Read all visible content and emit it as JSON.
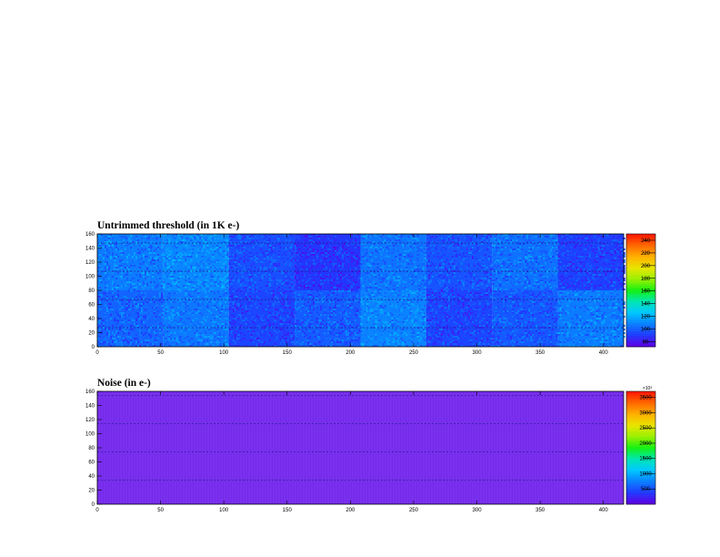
{
  "chart_data": [
    {
      "type": "heatmap",
      "title": "Untrimmed threshold (in 1K e-)",
      "xlim": [
        0,
        416
      ],
      "ylim": [
        0,
        160
      ],
      "x_ticks": [
        0,
        50,
        100,
        150,
        200,
        250,
        300,
        350,
        400
      ],
      "y_ticks": [
        0,
        20,
        40,
        60,
        80,
        100,
        120,
        140,
        160
      ],
      "colorbar": {
        "range": [
          72,
          250
        ],
        "ticks": [
          80,
          100,
          120,
          140,
          160,
          180,
          200,
          220,
          240
        ],
        "exponent_label": ""
      },
      "block_columns": [
        0,
        52,
        104,
        156,
        208,
        260,
        312,
        364,
        416
      ],
      "block_rows": [
        0,
        80,
        160
      ],
      "block_means": [
        [
          100,
          105,
          92,
          98,
          108,
          92,
          97,
          106
        ],
        [
          106,
          109,
          95,
          88,
          104,
          96,
          103,
          91
        ]
      ],
      "dashed_rows": [
        27,
        67,
        107,
        147
      ],
      "grid": false
    },
    {
      "type": "heatmap",
      "title": "Noise (in e-)",
      "xlim": [
        0,
        416
      ],
      "ylim": [
        0,
        160
      ],
      "x_ticks": [
        0,
        50,
        100,
        150,
        200,
        250,
        300,
        350,
        400
      ],
      "y_ticks": [
        0,
        20,
        40,
        60,
        80,
        100,
        120,
        140,
        160
      ],
      "colorbar": {
        "range": [
          0,
          3700
        ],
        "ticks": [
          500,
          1000,
          1500,
          2000,
          2500,
          3000,
          3500
        ],
        "exponent_label": "×10³"
      },
      "uniform_value": 20,
      "dashed_rows": [
        34,
        74,
        114,
        154
      ],
      "grid": false
    }
  ],
  "colors": {
    "palette": [
      "#5c00e6",
      "#1e3cff",
      "#0a82ff",
      "#00c8ff",
      "#00e6b4",
      "#14f014",
      "#96f000",
      "#e6e600",
      "#ffb400",
      "#ff6e00",
      "#ff1e00"
    ],
    "noise_fill": "#7a30ee"
  }
}
